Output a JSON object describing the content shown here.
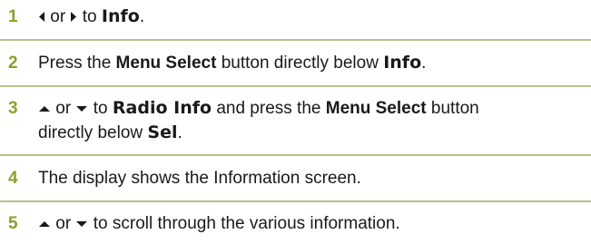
{
  "accent_color": "#8aa02d",
  "divider_color": "#b7c08a",
  "steps": [
    {
      "number": "1",
      "or": "or",
      "to": "to",
      "info": "Info",
      "period": ".",
      "icons": [
        "left-arrow-icon",
        "right-arrow-icon"
      ]
    },
    {
      "number": "2",
      "press": "Press the",
      "menu_select": "Menu Select",
      "button_below": "button directly below",
      "info": "Info",
      "period": "."
    },
    {
      "number": "3",
      "or": "or",
      "to": "to",
      "radio_info": "Radio Info",
      "and_press": "and press the",
      "menu_select": "Menu Select",
      "button": "button",
      "directly_below": "directly below",
      "sel": "Sel",
      "period": ".",
      "icons": [
        "up-arrow-icon",
        "down-arrow-icon"
      ]
    },
    {
      "number": "4",
      "text": "The display shows the Information screen."
    },
    {
      "number": "5",
      "or": "or",
      "rest": "to scroll through the various information.",
      "icons": [
        "up-arrow-icon",
        "down-arrow-icon"
      ]
    }
  ]
}
